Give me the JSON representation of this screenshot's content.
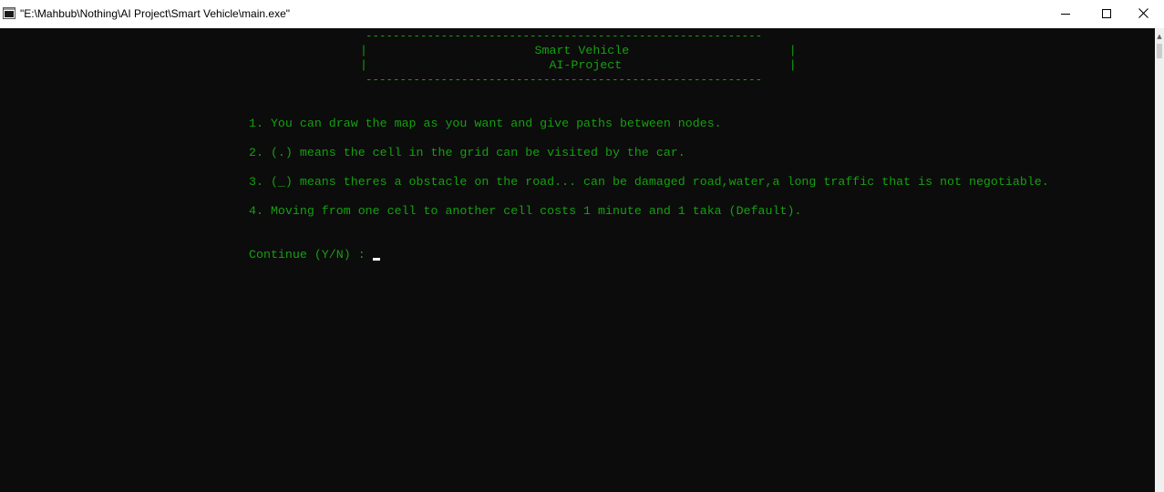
{
  "window": {
    "title": "\"E:\\Mahbub\\Nothing\\AI Project\\Smart Vehicle\\main.exe\"",
    "icons": {
      "app": "console-app-icon",
      "minimize": "minimize-icon",
      "maximize": "maximize-icon",
      "close": "close-icon"
    }
  },
  "console": {
    "colors": {
      "background": "#0c0c0c",
      "text": "#13a10e",
      "cursor": "#ffffff"
    },
    "banner": {
      "border_top": "----------------------------------------------------------",
      "title_line": "|                       Smart Vehicle                      |",
      "subtitle_line": "|                         AI-Project                       |",
      "border_bottom": "----------------------------------------------------------"
    },
    "instructions": [
      "1. You can draw the map as you want and give paths between nodes.",
      "2. (.) means the cell in the grid can be visited by the car.",
      "3. (_) means theres a obstacle on the road... can be damaged road,water,a long traffic that is not negotiable.",
      "4. Moving from one cell to another cell costs 1 minute and 1 taka (Default)."
    ],
    "prompt": "Continue (Y/N) :"
  }
}
